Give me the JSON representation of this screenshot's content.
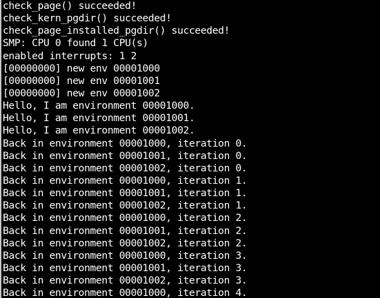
{
  "terminal": {
    "lines": [
      "check_page() succeeded!",
      "check_kern_pgdir() succeeded!",
      "check_page_installed_pgdir() succeeded!",
      "SMP: CPU 0 found 1 CPU(s)",
      "enabled interrupts: 1 2",
      "[00000000] new env 00001000",
      "[00000000] new env 00001001",
      "[00000000] new env 00001002",
      "Hello, I am environment 00001000.",
      "Hello, I am environment 00001001.",
      "Hello, I am environment 00001002.",
      "Back in environment 00001000, iteration 0.",
      "Back in environment 00001001, iteration 0.",
      "Back in environment 00001002, iteration 0.",
      "Back in environment 00001000, iteration 1.",
      "Back in environment 00001001, iteration 1.",
      "Back in environment 00001002, iteration 1.",
      "Back in environment 00001000, iteration 2.",
      "Back in environment 00001001, iteration 2.",
      "Back in environment 00001002, iteration 2.",
      "Back in environment 00001000, iteration 3.",
      "Back in environment 00001001, iteration 3.",
      "Back in environment 00001002, iteration 3.",
      "Back in environment 00001000, iteration 4."
    ],
    "colors": {
      "background": "#000000",
      "text": "#ffffff",
      "border": "#c8c8c8"
    }
  }
}
